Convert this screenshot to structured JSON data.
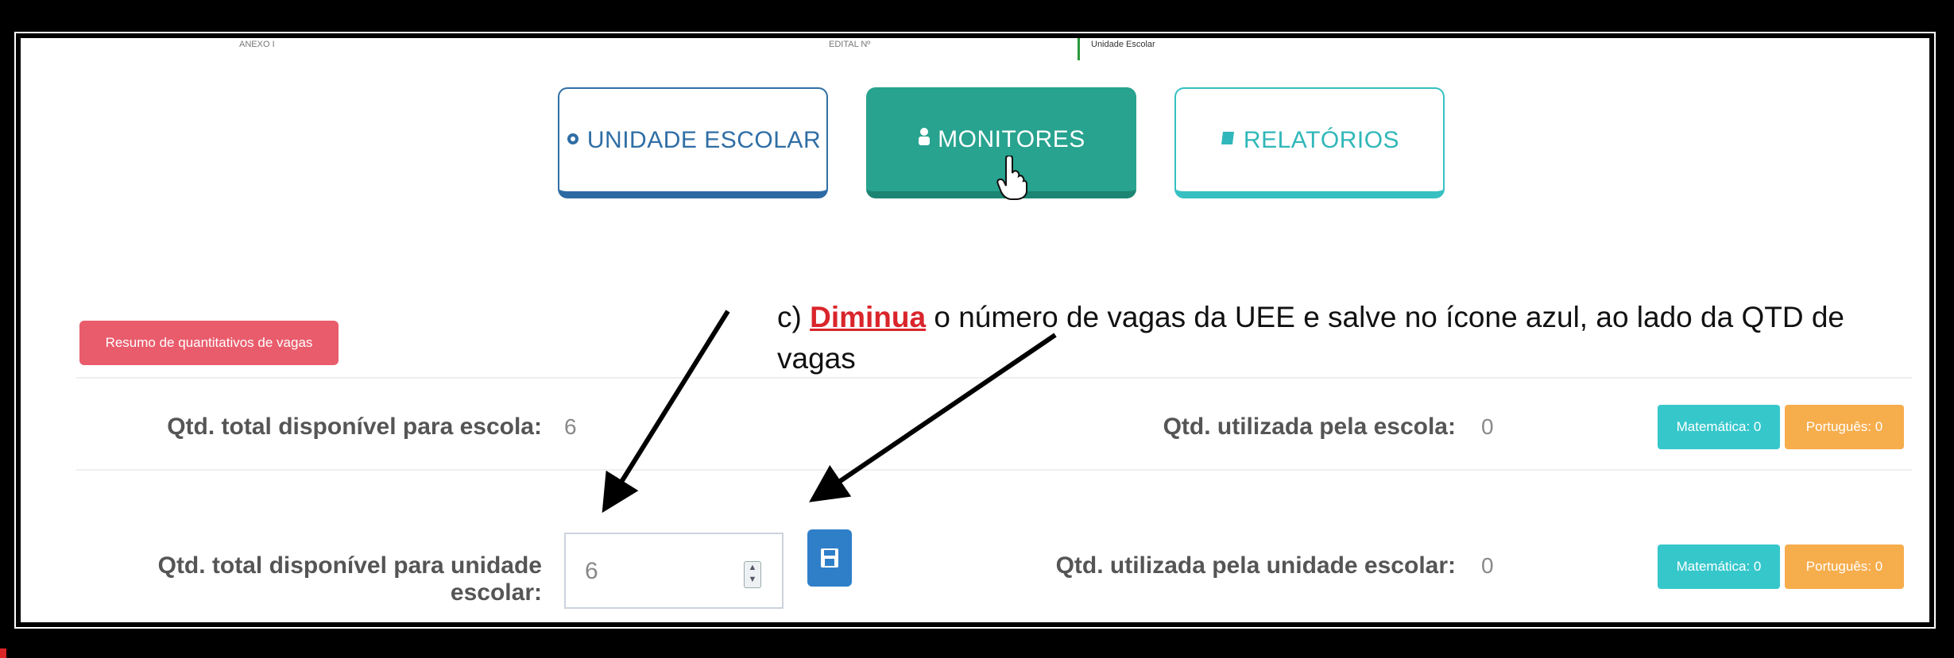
{
  "top_strip": {
    "left_label": "ANEXO I",
    "middle_label": "EDITAL Nº",
    "right_label": "Unidade Escolar"
  },
  "nav": {
    "unidade": {
      "label": "UNIDADE ESCOLAR",
      "icon": "gear-icon"
    },
    "monitores": {
      "label": "MONITORES",
      "icon": "user-icon"
    },
    "relatorios": {
      "label": "RELATÓRIOS",
      "icon": "book-icon"
    }
  },
  "badge": {
    "label": "Resumo de quantitativos de vagas"
  },
  "annotation": {
    "prefix": "c) ",
    "highlight": "Diminua",
    "rest": " o número de vagas da UEE e salve no ícone azul, ao lado da QTD de vagas"
  },
  "row1": {
    "label": "Qtd. total disponível para escola:",
    "value": "6",
    "used_label": "Qtd. utilizada pela escola:",
    "used_value": "0",
    "pill_math": "Matemática: 0",
    "pill_port": "Português: 0"
  },
  "row2": {
    "label": "Qtd. total disponível para unidade escolar:",
    "input_value": "6",
    "used_label": "Qtd. utilizada pela unidade escolar:",
    "used_value": "0",
    "pill_math": "Matemática: 0",
    "pill_port": "Português: 0"
  },
  "colors": {
    "teal_button": "#27a38f",
    "blue_outline": "#2f6ea5",
    "cyan_outline": "#35bfc1",
    "badge_red": "#e95c6c",
    "pill_teal": "#36c7cb",
    "pill_orange": "#f6ad4c",
    "save_blue": "#2f7fc8",
    "highlight_red": "#d9252b"
  }
}
